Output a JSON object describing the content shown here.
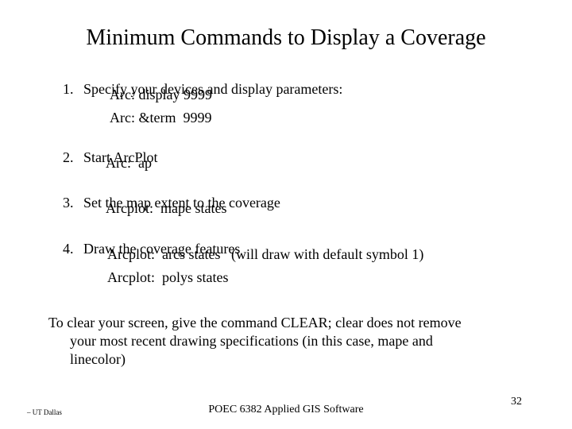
{
  "slide": {
    "title": "Minimum Commands to Display a Coverage",
    "steps": [
      {
        "number": "1.",
        "text": "Specify your devices and display parameters:",
        "commands": [
          "Arc: display 9999",
          "Arc: &term  9999"
        ]
      },
      {
        "number": "2.",
        "text": "Start ArcPlot",
        "commands": [
          "Arc:  ap"
        ]
      },
      {
        "number": "3.",
        "text": "Set the map extent to the coverage",
        "commands": [
          "Arcplot:  mape states"
        ]
      },
      {
        "number": "4.",
        "text": "Draw the coverage features",
        "commands": [
          "Arcplot:  arcs states   (will draw with default symbol 1)",
          "Arcplot:  polys states"
        ]
      }
    ],
    "note": {
      "line1": "To clear your screen, give the command CLEAR; clear does not remove",
      "line2": "your most recent drawing specifications (in this case, mape and",
      "line3": "linecolor)"
    }
  },
  "footer": {
    "left": "– UT Dallas",
    "center": "POEC 6382 Applied GIS Software",
    "page_number": "32"
  }
}
